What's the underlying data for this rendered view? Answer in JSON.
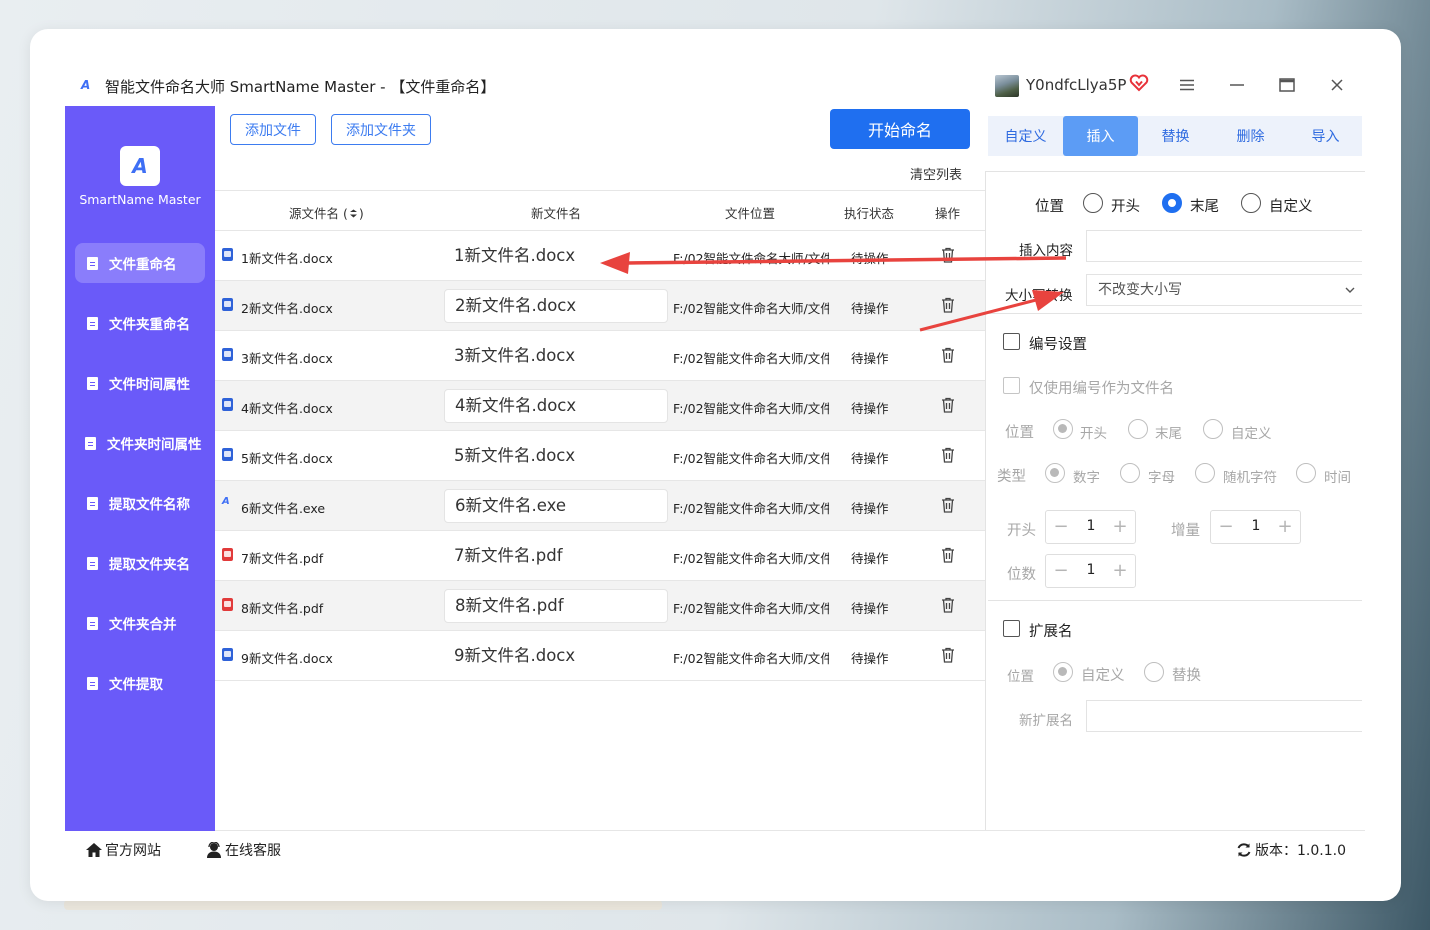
{
  "window": {
    "title": "智能文件命名大师 SmartName Master - 【文件重命名】",
    "user_name": "Y0ndfcLlya5P"
  },
  "sidebar": {
    "logo_text": "SmartName Master",
    "items": [
      {
        "label": "文件重命名",
        "active": true
      },
      {
        "label": "文件夹重命名"
      },
      {
        "label": "文件时间属性"
      },
      {
        "label": "文件夹时间属性"
      },
      {
        "label": "提取文件名称"
      },
      {
        "label": "提取文件夹名"
      },
      {
        "label": "文件夹合并"
      },
      {
        "label": "文件提取"
      }
    ]
  },
  "toolbar": {
    "add_file": "添加文件",
    "add_folder": "添加文件夹",
    "start": "开始命名",
    "clear_list": "清空列表"
  },
  "table": {
    "headers": {
      "source": "源文件名 (",
      "source_suffix": ")",
      "new_name": "新文件名",
      "location": "文件位置",
      "status": "执行状态",
      "action": "操作"
    },
    "rows": [
      {
        "icon": "docx",
        "source": "1新文件名.docx",
        "new": "1新文件名.docx",
        "location": "F:/02智能文件命名大师/文件",
        "status": "待操作"
      },
      {
        "icon": "docx",
        "source": "2新文件名.docx",
        "new": "2新文件名.docx",
        "location": "F:/02智能文件命名大师/文件",
        "status": "待操作"
      },
      {
        "icon": "docx",
        "source": "3新文件名.docx",
        "new": "3新文件名.docx",
        "location": "F:/02智能文件命名大师/文件",
        "status": "待操作"
      },
      {
        "icon": "docx",
        "source": "4新文件名.docx",
        "new": "4新文件名.docx",
        "location": "F:/02智能文件命名大师/文件",
        "status": "待操作"
      },
      {
        "icon": "docx",
        "source": "5新文件名.docx",
        "new": "5新文件名.docx",
        "location": "F:/02智能文件命名大师/文件",
        "status": "待操作"
      },
      {
        "icon": "exe",
        "source": "6新文件名.exe",
        "new": "6新文件名.exe",
        "location": "F:/02智能文件命名大师/文件",
        "status": "待操作"
      },
      {
        "icon": "pdf",
        "source": "7新文件名.pdf",
        "new": "7新文件名.pdf",
        "location": "F:/02智能文件命名大师/文件",
        "status": "待操作"
      },
      {
        "icon": "pdf",
        "source": "8新文件名.pdf",
        "new": "8新文件名.pdf",
        "location": "F:/02智能文件命名大师/文件",
        "status": "待操作"
      },
      {
        "icon": "docx",
        "source": "9新文件名.docx",
        "new": "9新文件名.docx",
        "location": "F:/02智能文件命名大师/文件",
        "status": "待操作"
      }
    ]
  },
  "tabs": [
    {
      "label": "自定义"
    },
    {
      "label": "插入",
      "active": true
    },
    {
      "label": "替换"
    },
    {
      "label": "删除"
    },
    {
      "label": "导入"
    }
  ],
  "panel": {
    "position_label": "位置",
    "pos_start": "开头",
    "pos_end": "末尾",
    "pos_custom": "自定义",
    "insert_content_label": "插入内容",
    "insert_content_value": "",
    "case_label": "大小写转换",
    "case_value": "不改变大小写",
    "numbering_label": "编号设置",
    "only_number_label": "仅使用编号作为文件名",
    "num_position_label": "位置",
    "num_pos_start": "开头",
    "num_pos_end": "末尾",
    "num_pos_custom": "自定义",
    "type_label": "类型",
    "type_number": "数字",
    "type_letter": "字母",
    "type_random": "随机字符",
    "type_time": "时间",
    "start_label": "开头",
    "start_value": "1",
    "increment_label": "增量",
    "increment_value": "1",
    "digits_label": "位数",
    "digits_value": "1",
    "ext_label": "扩展名",
    "ext_position_label": "位置",
    "ext_custom": "自定义",
    "ext_replace": "替换",
    "new_ext_label": "新扩展名",
    "new_ext_value": ""
  },
  "footer": {
    "website": "官方网站",
    "support": "在线客服",
    "version": "版本：1.0.1.0"
  },
  "colors": {
    "sidebar": "#6a5af9",
    "primary": "#1f6ff0",
    "arrow": "#e8433e"
  }
}
